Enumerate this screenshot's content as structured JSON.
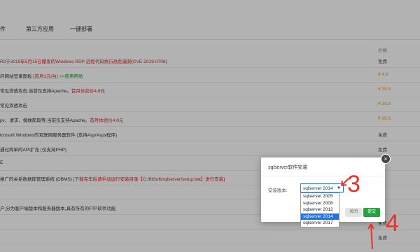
{
  "tabs": [
    "件",
    "第三方应用",
    "一键部署"
  ],
  "table": {
    "price_header": "价格",
    "rows": [
      {
        "name": "R2于2019年5月15日爆发的Windows RDP 远程代码执行高危漏洞(CVE-2019-0708)",
        "price": "免费",
        "name_color": "red",
        "price_color": "gray"
      },
      {
        "name": "问网站登录面板 (",
        "name_red": "首月1元/台",
        "name_tail": ") >>使用帮助",
        "price": "¥ 4.8",
        "name_color": "mixed",
        "price_color": "orange"
      },
      {
        "name": "常见渗透攻击,当前仅支持Apache。",
        "name_red": "首月体验价4.8元",
        "price": "¥ 39.8",
        "name_color": "mixed2",
        "price_color": "orange"
      },
      {
        "name": "常见渗透攻击",
        "price": "¥ 39.8",
        "name_color": "default",
        "price_color": "orange"
      },
      {
        "name": "pv、请求、蜘蛛爬取等,当前仅支持Apache。",
        "name_red": "首月体验价4.8元",
        "price": "¥ 39.8",
        "name_color": "mixed2",
        "price_color": "orange"
      },
      {
        "name": "icrosoft Windows的互联网服务器软件 (支持Asp/Aspx程序)",
        "price": "免费",
        "name_color": "default",
        "price_color": "gray"
      },
      {
        "name": "通过简单的API扩充 (仅支持PHP)",
        "price": "免费",
        "name_color": "default",
        "price_color": "gray"
      },
      {
        "name": "E",
        "price": "",
        "name_color": "default",
        "price_color": "gray"
      },
      {
        "name": "推广的关系数据库管理系统 (DBMS) ",
        "name_red": "[下载完毕后请手动运行安装目录【C:/BtSoft/sqlserver/setup.bat】进行安装]",
        "price": "",
        "name_color": "mixed2",
        "price_color": "gray"
      },
      {
        "name": "",
        "price": "",
        "name_color": "default",
        "price_color": "gray"
      },
      {
        "name": "户,分为客户端版本和服务器版本,具有所有的FTP软件功能",
        "price": "",
        "name_color": "default",
        "price_color": "gray"
      },
      {
        "name": "",
        "price": "免费",
        "name_color": "default",
        "price_color": "gray"
      },
      {
        "name": "",
        "price": "免费",
        "name_color": "default",
        "price_color": "gray"
      }
    ]
  },
  "dialog": {
    "title": "sqlserver软件安装",
    "close_glyph": "×",
    "version_label": "安装版本:",
    "selected": "sqlserver 2014",
    "caret": "▼",
    "options": [
      "sqlserver 2005",
      "sqlserver 2008",
      "sqlserver 2012",
      "sqlserver 2014",
      "sqlserver 2017"
    ],
    "active_index": 3,
    "close_button": "关闭",
    "submit_button": "提交"
  },
  "annotations": {
    "step_3": "3",
    "step_4": "4",
    "color": "#e8322a"
  }
}
